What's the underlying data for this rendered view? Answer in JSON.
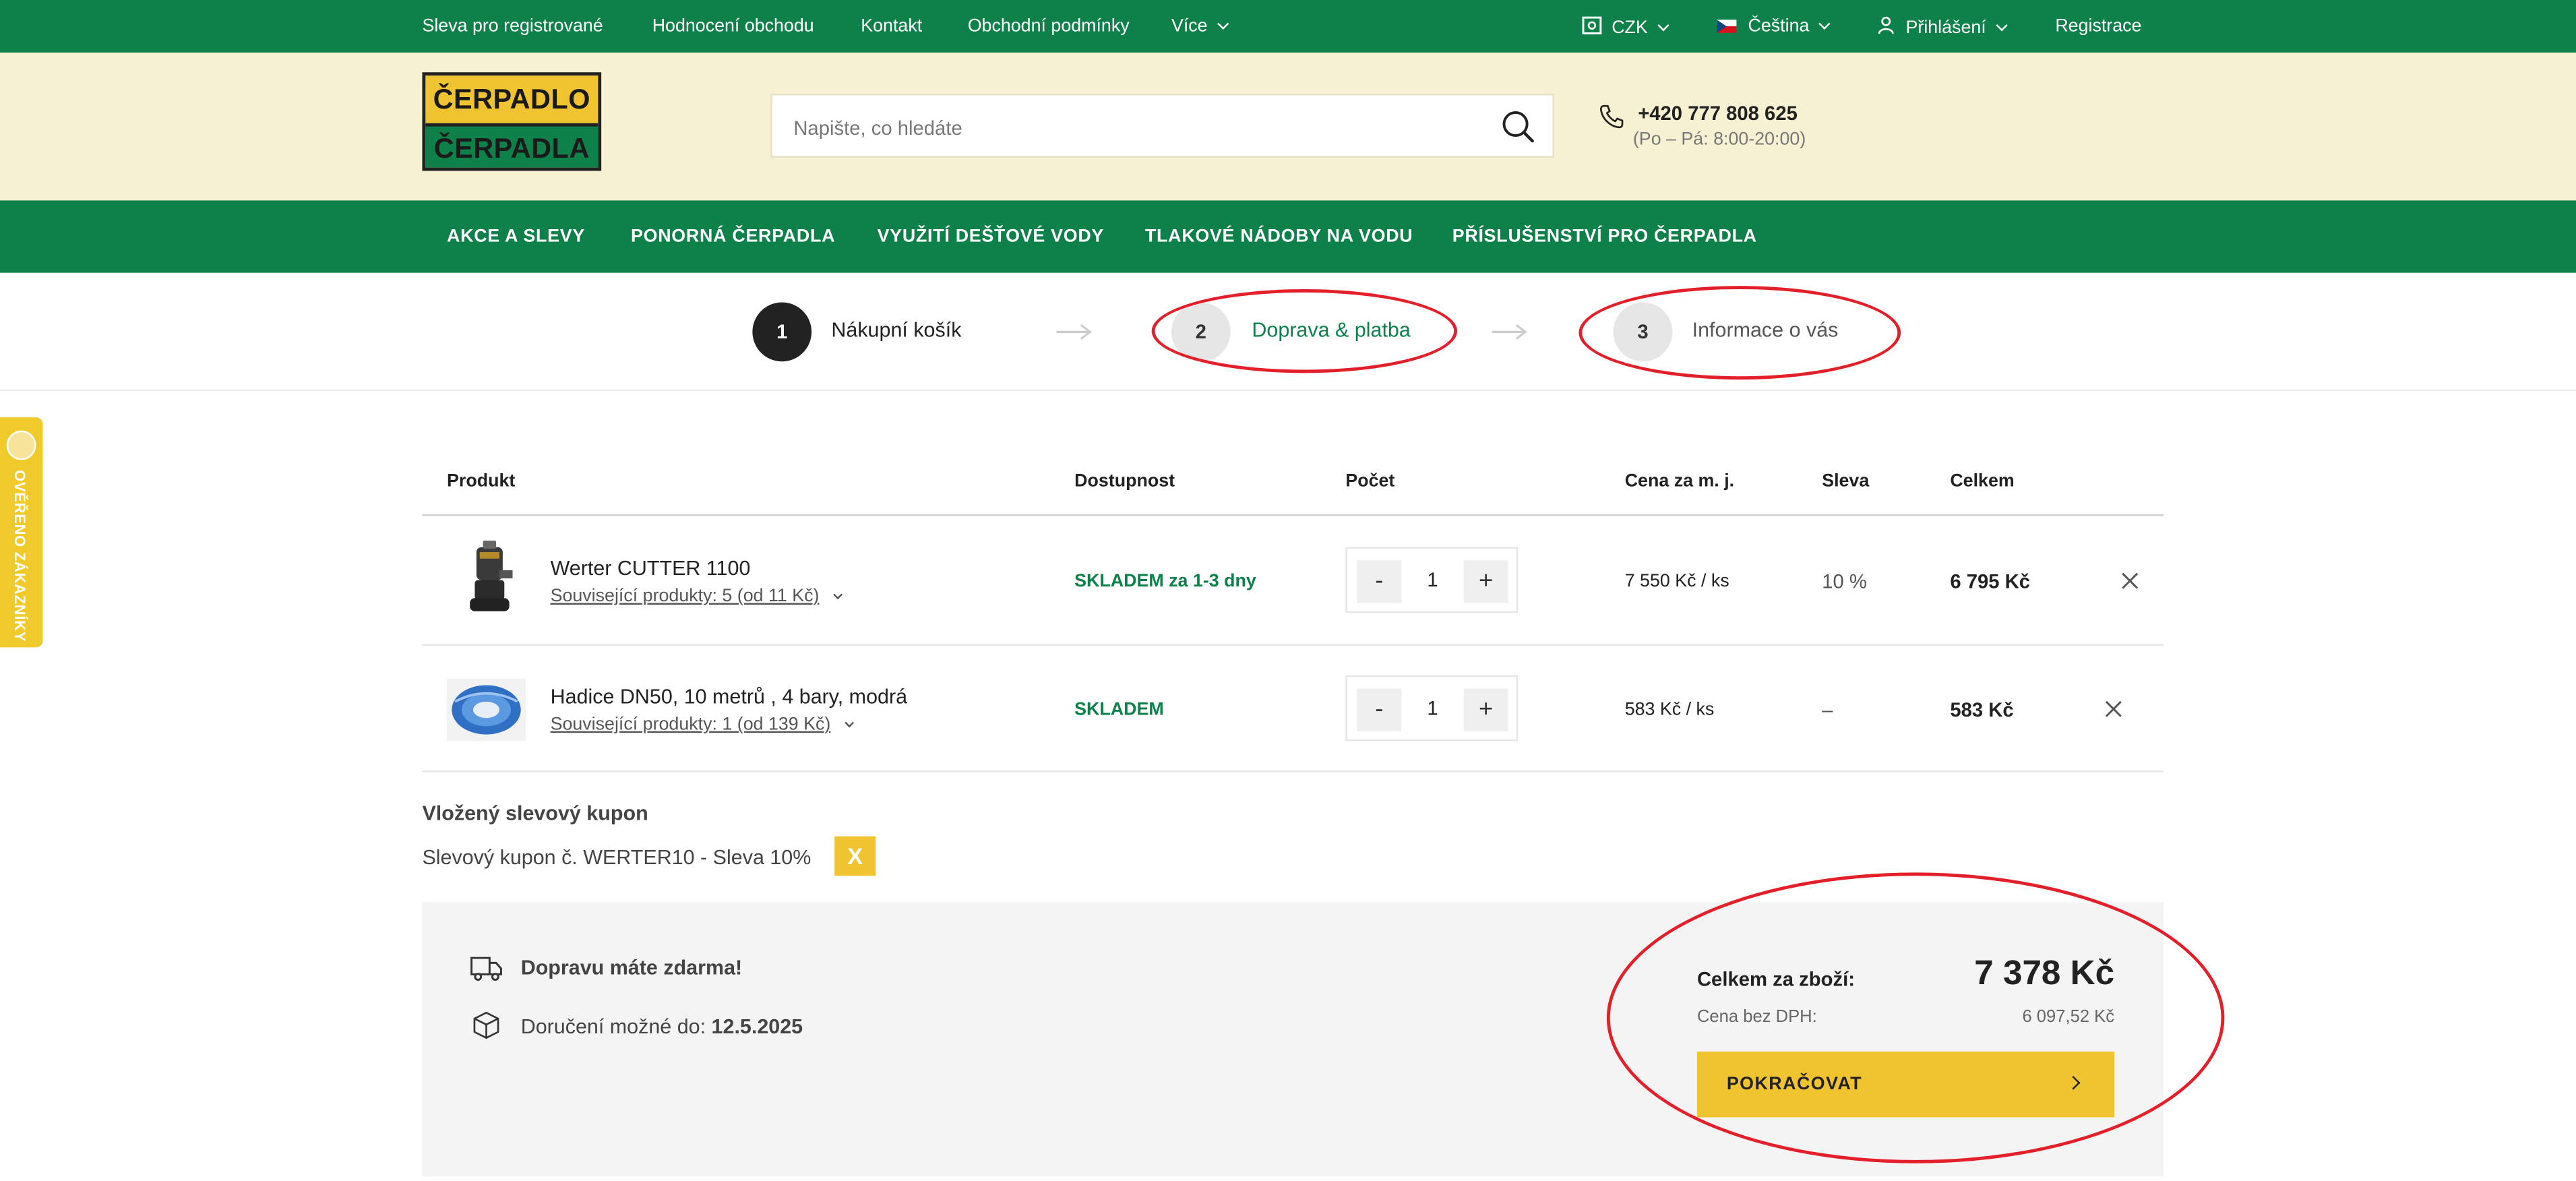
{
  "topbar": {
    "links": [
      "Sleva pro registrované",
      "Hodnocení obchodu",
      "Kontakt",
      "Obchodní podmínky",
      "Více"
    ],
    "currency": "CZK",
    "language": "Čeština",
    "login": "Přihlášení",
    "register": "Registrace"
  },
  "header": {
    "logo_line1": "ČERPADLO",
    "logo_line2": "ČERPADLA",
    "search_placeholder": "Napište, co hledáte",
    "phone": "+420 777 808 625",
    "hours": "(Po – Pá: 8:00-20:00)"
  },
  "nav": [
    "AKCE A SLEVY",
    "PONORNÁ ČERPADLA",
    "VYUŽITÍ DEŠŤOVÉ VODY",
    "TLAKOVÉ NÁDOBY NA VODU",
    "PŘÍSLUŠENSTVÍ PRO ČERPADLA"
  ],
  "steps": [
    {
      "number": "1",
      "label": "Nákupní košík"
    },
    {
      "number": "2",
      "label": "Doprava & platba"
    },
    {
      "number": "3",
      "label": "Informace o vás"
    }
  ],
  "side_badge": "OVĚŘENO ZÁKAZNÍKY",
  "table": {
    "headers": [
      "Produkt",
      "Dostupnost",
      "Počet",
      "Cena za m. j.",
      "Sleva",
      "Celkem"
    ],
    "rows": [
      {
        "name": "Werter CUTTER 1100",
        "related": "Související produkty: 5 (od 11 Kč)",
        "stock": "SKLADEM za 1-3 dny",
        "qty": "1",
        "unit_price": "7 550 Kč / ks",
        "discount": "10 %",
        "total": "6 795 Kč"
      },
      {
        "name": "Hadice DN50, 10 metrů , 4 bary, modrá",
        "related": "Související produkty: 1 (od 139 Kč)",
        "stock": "SKLADEM",
        "qty": "1",
        "unit_price": "583 Kč / ks",
        "discount": "–",
        "total": "583 Kč"
      }
    ],
    "qty_minus": "-",
    "qty_plus": "+"
  },
  "coupon": {
    "heading": "Vložený slevový kupon",
    "text": "Slevový kupon č. WERTER10 - Sleva 10%",
    "remove": "X"
  },
  "summary": {
    "shipping_free": "Dopravu máte zdarma!",
    "delivery_label": "Doručení možné do:",
    "delivery_date": "12.5.2025",
    "total_label": "Celkem za zboží:",
    "total_value": "7 378 Kč",
    "net_label": "Cena bez DPH:",
    "net_value": "6 097,52 Kč",
    "continue": "POKRAČOVAT"
  },
  "colors": {
    "brand_green": "#0e8049",
    "accent_yellow": "#f0c330",
    "annotation_red": "#e3202a"
  }
}
